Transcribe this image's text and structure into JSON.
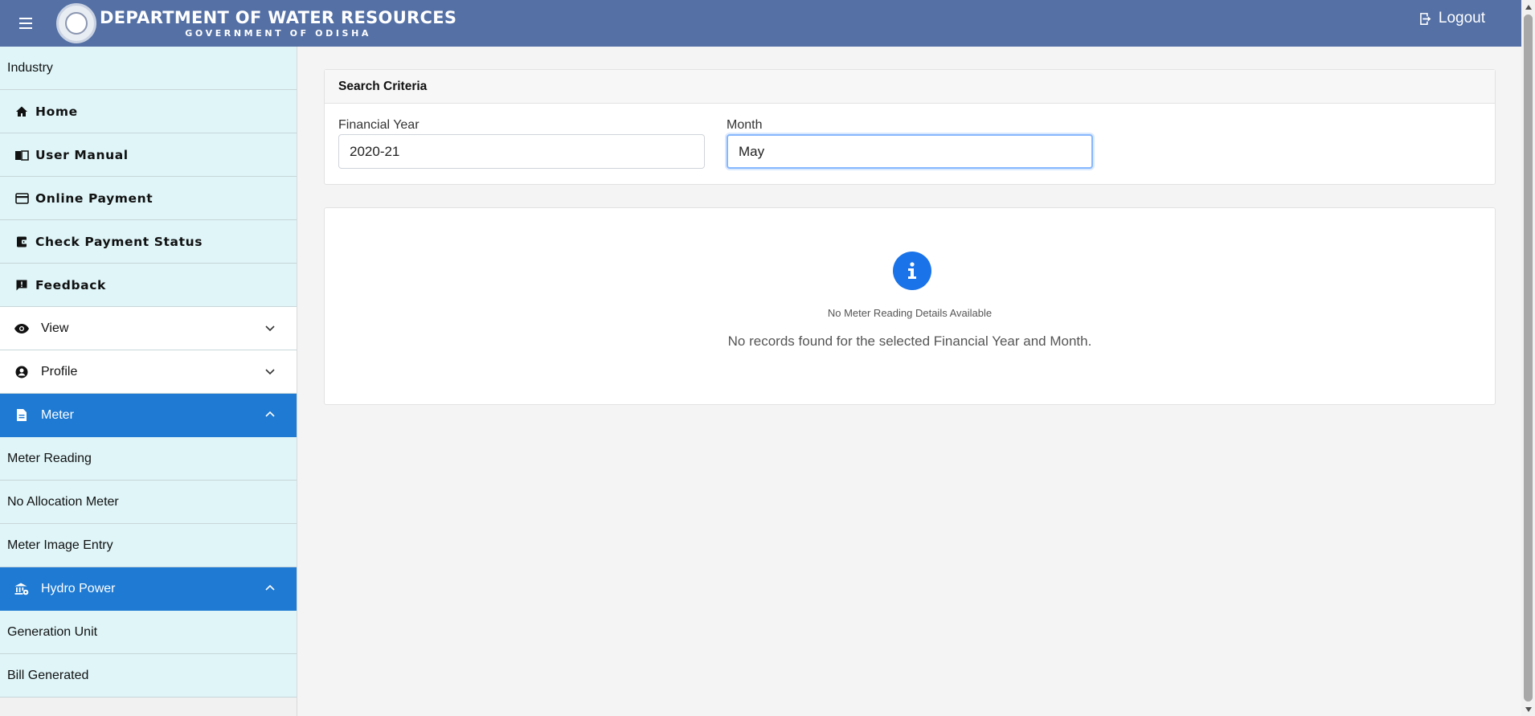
{
  "header": {
    "title": "DEPARTMENT OF WATER RESOURCES",
    "subtitle": "GOVERNMENT OF ODISHA",
    "logout_label": "Logout"
  },
  "sidebar": {
    "industry_label": "Industry",
    "home": "Home",
    "user_manual": "User Manual",
    "online_payment": "Online Payment",
    "check_payment_status": "Check Payment Status",
    "feedback": "Feedback",
    "view": "View",
    "profile": "Profile",
    "meter": "Meter",
    "meter_reading": "Meter Reading",
    "no_allocation_meter": "No Allocation Meter",
    "meter_image_entry": "Meter Image Entry",
    "hydro_power": "Hydro Power",
    "generation_unit": "Generation Unit",
    "bill_generated": "Bill Generated"
  },
  "search": {
    "title": "Search Criteria",
    "financial_year_label": "Financial Year",
    "financial_year_value": "2020-21",
    "month_label": "Month",
    "month_value": "May"
  },
  "empty_state": {
    "title": "No Meter Reading Details Available",
    "description": "No records found for the selected Financial Year and Month."
  },
  "colors": {
    "header_bg": "#5470a5",
    "active_bg": "#1e7ad3",
    "nav_bg": "#dff5f8",
    "info_icon": "#1a73e8"
  }
}
